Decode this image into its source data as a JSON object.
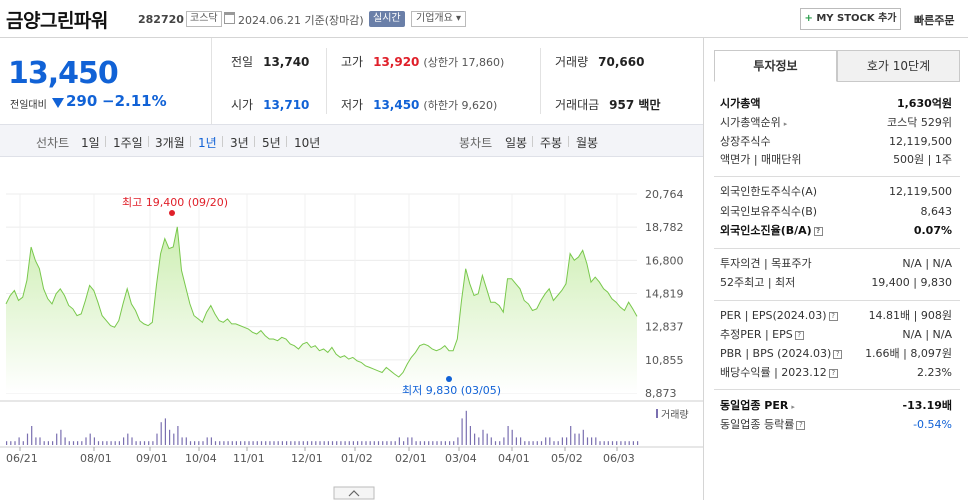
{
  "header": {
    "name": "금양그린파워",
    "code": "282720",
    "market": "코스닥",
    "date": "2024.06.21 기준(장마감)",
    "realtime": "실시간",
    "company": "기업개요 ▾",
    "mystock": "MY STOCK 추가",
    "mystock_plus": "+",
    "quick_order": "빠른주문"
  },
  "price": {
    "current": "13,450",
    "change_label": "전일대비",
    "change": "290",
    "change_pct": "−2.11%"
  },
  "stats": {
    "prev_label": "전일",
    "prev": "13,740",
    "high_label": "고가",
    "high": "13,920",
    "upper_limit": "(상한가 17,860)",
    "volume_label": "거래량",
    "volume": "70,660",
    "open_label": "시가",
    "open": "13,710",
    "low_label": "저가",
    "low": "13,450",
    "lower_limit": "(하한가 9,620)",
    "amount_label": "거래대금",
    "amount": "957 백만"
  },
  "toolbar": {
    "line_label": "선차트",
    "periods": [
      "1일",
      "1주일",
      "3개월",
      "1년",
      "3년",
      "5년",
      "10년"
    ],
    "active_period": "1년",
    "candle_label": "봉차트",
    "candles": [
      "일봉",
      "주봉",
      "월봉"
    ]
  },
  "chart_data": {
    "type": "area",
    "y_ticks": [
      "20,764",
      "18,782",
      "16,800",
      "14,819",
      "12,837",
      "10,855",
      "8,873"
    ],
    "ylim": [
      8873,
      20764
    ],
    "x_ticks": [
      "06/21",
      "08/01",
      "09/01",
      "10/04",
      "11/01",
      "12/01",
      "01/02",
      "02/01",
      "03/04",
      "04/01",
      "05/02",
      "06/03"
    ],
    "values": [
      14200,
      14700,
      15000,
      14400,
      14600,
      15600,
      17600,
      16800,
      16300,
      15100,
      14500,
      14200,
      14800,
      15100,
      14700,
      14100,
      13900,
      13500,
      13600,
      14400,
      15300,
      15000,
      14300,
      13500,
      13200,
      12900,
      12800,
      13200,
      14200,
      15100,
      14200,
      13800,
      13200,
      13000,
      12900,
      13100,
      15300,
      17200,
      18100,
      17500,
      17600,
      18800,
      16200,
      15200,
      14200,
      13500,
      13300,
      13100,
      13700,
      14100,
      13600,
      13200,
      13100,
      13300,
      13000,
      13000,
      12900,
      12800,
      12700,
      12500,
      12400,
      12600,
      12300,
      12100,
      12100,
      12000,
      12200,
      12100,
      11800,
      11700,
      11500,
      11800,
      11900,
      11600,
      11700,
      11400,
      11500,
      11300,
      11600,
      11200,
      11000,
      11100,
      10900,
      11000,
      10800,
      10700,
      10500,
      10400,
      10300,
      10200,
      10100,
      10400,
      10200,
      10000,
      9830,
      10100,
      10600,
      11000,
      11300,
      11700,
      11800,
      11700,
      11500,
      11400,
      11500,
      11700,
      11400,
      11400,
      12100,
      14400,
      16300,
      15400,
      14700,
      14800,
      15900,
      15100,
      14300,
      14300,
      14100,
      13700,
      15700,
      15700,
      15400,
      15100,
      14400,
      14200,
      13800,
      13900,
      14400,
      14800,
      15100,
      14400,
      14700,
      15000,
      15400,
      17200,
      16800,
      17000,
      17400,
      16600,
      15500,
      15800,
      15500,
      15100,
      14900,
      14500,
      14300,
      14000,
      13800,
      14300,
      13900,
      13450
    ],
    "volume": [
      1,
      1,
      1,
      2,
      1,
      3,
      5,
      2,
      2,
      1,
      1,
      1,
      3,
      4,
      2,
      1,
      1,
      1,
      1,
      2,
      3,
      2,
      1,
      1,
      1,
      1,
      1,
      1,
      2,
      3,
      2,
      1,
      1,
      1,
      1,
      1,
      3,
      6,
      7,
      4,
      3,
      5,
      2,
      2,
      1,
      1,
      1,
      1,
      2,
      2,
      1,
      1,
      1,
      1,
      1,
      1,
      1,
      1,
      1,
      1,
      1,
      1,
      1,
      1,
      1,
      1,
      1,
      1,
      1,
      1,
      1,
      1,
      1,
      1,
      1,
      1,
      1,
      1,
      1,
      1,
      1,
      1,
      1,
      1,
      1,
      1,
      1,
      1,
      1,
      1,
      1,
      1,
      1,
      1,
      2,
      1,
      2,
      2,
      1,
      1,
      1,
      1,
      1,
      1,
      1,
      1,
      1,
      1,
      2,
      7,
      9,
      5,
      3,
      2,
      4,
      3,
      2,
      1,
      1,
      2,
      5,
      4,
      2,
      2,
      1,
      1,
      1,
      1,
      1,
      2,
      2,
      1,
      1,
      2,
      2,
      5,
      3,
      3,
      4,
      2,
      2,
      2,
      1,
      1,
      1,
      1,
      1,
      1,
      1,
      1,
      1,
      1
    ],
    "high_label": "최고 19,400 (09/20)",
    "low_label": "최저 9,830 (03/05)",
    "volume_label": "거래량",
    "colors": {
      "line": "#79c84c",
      "fill_top": "#cdeeb2",
      "fill_bottom": "#ffffff",
      "high": "#e0202a",
      "low": "#1162d6",
      "volume": "#7a6fb0"
    }
  },
  "right_panel": {
    "tabs": [
      "투자정보",
      "호가 10단계"
    ],
    "rows": [
      {
        "k": "시가총액",
        "v": "1,630억원",
        "bold": true
      },
      {
        "k": "시가총액순위",
        "v": "코스닥 529위",
        "caret": true
      },
      {
        "k": "상장주식수",
        "v": "12,119,500"
      },
      {
        "k": "액면가 | 매매단위",
        "v": "500원 | 1주"
      },
      {
        "k": "외국인한도주식수(A)",
        "v": "12,119,500"
      },
      {
        "k": "외국인보유주식수(B)",
        "v": "8,643"
      },
      {
        "k": "외국인소진율(B/A)",
        "v": "0.07%",
        "bold": true,
        "q": true
      },
      {
        "k": "투자의견 | 목표주가",
        "v": "N/A | N/A"
      },
      {
        "k": "52주최고 | 최저",
        "v": "19,400 | 9,830"
      },
      {
        "k": "PER | EPS(2024.03)",
        "v": "14.81배 | 908원",
        "q": true
      },
      {
        "k": "추정PER | EPS",
        "v": "N/A | N/A",
        "q": true
      },
      {
        "k": "PBR | BPS (2024.03)",
        "v": "1.66배 | 8,097원",
        "q": true
      },
      {
        "k": "배당수익률 | 2023.12",
        "v": "2.23%",
        "q": true
      },
      {
        "k": "동일업종 PER",
        "v": "-13.19배",
        "bold": true,
        "caret": true
      },
      {
        "k": "동일업종 등락률",
        "v": "-0.54%",
        "blue": true,
        "q": true
      }
    ]
  }
}
